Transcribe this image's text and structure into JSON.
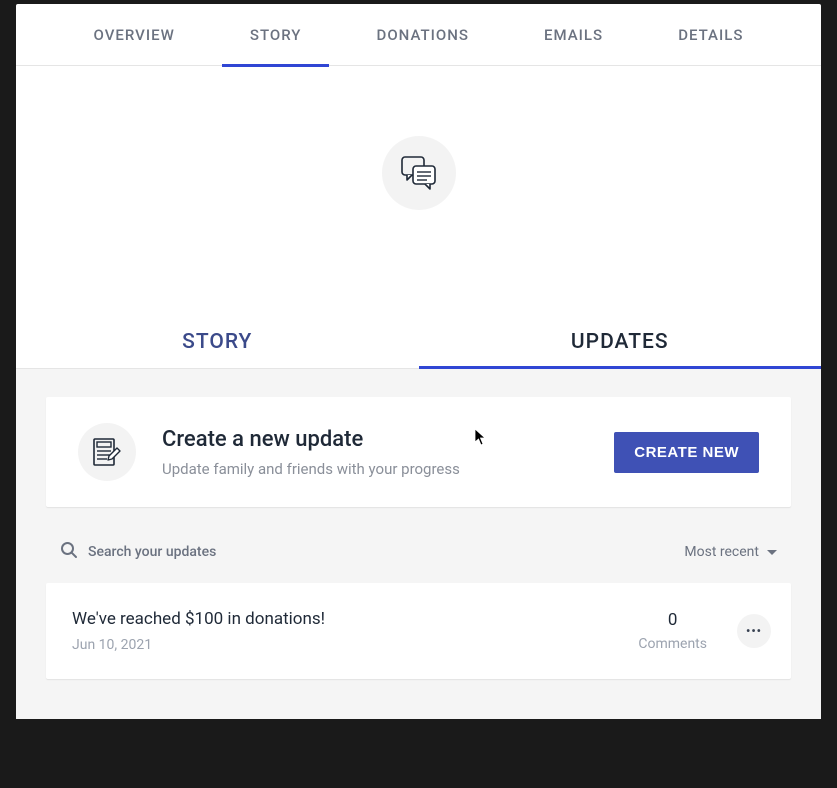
{
  "top_nav": {
    "items": [
      {
        "label": "OVERVIEW"
      },
      {
        "label": "STORY"
      },
      {
        "label": "DONATIONS"
      },
      {
        "label": "EMAILS"
      },
      {
        "label": "DETAILS"
      }
    ],
    "active_index": 1
  },
  "sub_tabs": {
    "items": [
      {
        "label": "STORY"
      },
      {
        "label": "UPDATES"
      }
    ],
    "active_index": 1
  },
  "create_panel": {
    "title": "Create a new update",
    "subtitle": "Update family and friends with your progress",
    "button": "CREATE NEW"
  },
  "search": {
    "placeholder": "Search your updates"
  },
  "sort": {
    "label": "Most recent"
  },
  "updates": [
    {
      "title": "We've reached $100 in donations!",
      "date": "Jun 10, 2021",
      "comments_count": "0",
      "comments_label": "Comments"
    }
  ]
}
